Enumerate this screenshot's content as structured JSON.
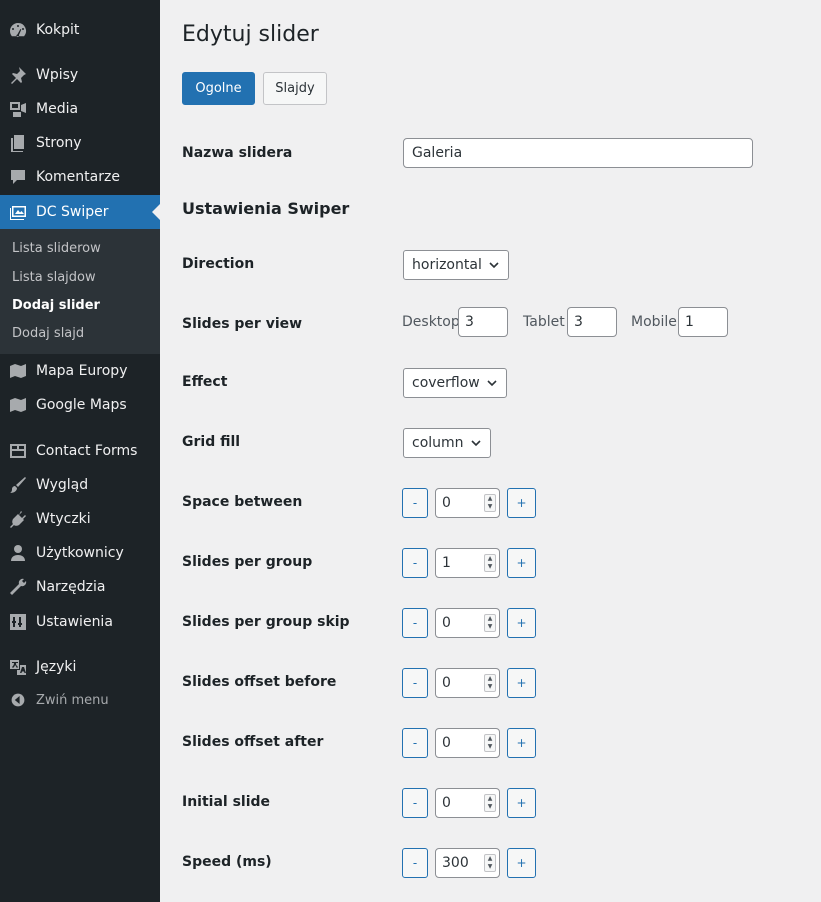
{
  "sidebar": {
    "items": [
      {
        "id": "kokpit",
        "label": "Kokpit",
        "icon": "dashboard-icon"
      },
      {
        "id": "wpisy",
        "label": "Wpisy",
        "icon": "pin-icon"
      },
      {
        "id": "media",
        "label": "Media",
        "icon": "media-icon"
      },
      {
        "id": "strony",
        "label": "Strony",
        "icon": "page-icon"
      },
      {
        "id": "komentarze",
        "label": "Komentarze",
        "icon": "comment-icon"
      },
      {
        "id": "dc-swiper",
        "label": "DC Swiper",
        "icon": "images-icon"
      },
      {
        "id": "mapa-europy",
        "label": "Mapa Europy",
        "icon": "map-icon"
      },
      {
        "id": "google-maps",
        "label": "Google Maps",
        "icon": "map-icon"
      },
      {
        "id": "contact-forms",
        "label": "Contact Forms",
        "icon": "forms-icon"
      },
      {
        "id": "wyglad",
        "label": "Wygląd",
        "icon": "brush-icon"
      },
      {
        "id": "wtyczki",
        "label": "Wtyczki",
        "icon": "plugin-icon"
      },
      {
        "id": "uzytkownicy",
        "label": "Użytkownicy",
        "icon": "user-icon"
      },
      {
        "id": "narzedzia",
        "label": "Narzędzia",
        "icon": "wrench-icon"
      },
      {
        "id": "ustawienia",
        "label": "Ustawienia",
        "icon": "settings-icon"
      },
      {
        "id": "jezyki",
        "label": "Języki",
        "icon": "translation-icon"
      }
    ],
    "submenu": [
      "Lista sliderow",
      "Lista slajdow",
      "Dodaj slider",
      "Dodaj slajd"
    ],
    "collapse_label": "Zwiń menu"
  },
  "page": {
    "title": "Edytuj slider",
    "tabs": {
      "general": "Ogolne",
      "slides": "Slajdy"
    }
  },
  "form": {
    "name_label": "Nazwa slidera",
    "name_value": "Galeria",
    "section_title": "Ustawienia Swiper",
    "direction_label": "Direction",
    "direction_value": "horizontal",
    "spv_label": "Slides per view",
    "spv": {
      "desktop_label": "Desktop",
      "desktop_value": "3",
      "tablet_label": "Tablet",
      "tablet_value": "3",
      "mobile_label": "Mobile",
      "mobile_value": "1"
    },
    "effect_label": "Effect",
    "effect_value": "coverflow",
    "grid_fill_label": "Grid fill",
    "grid_fill_value": "column",
    "minus": "-",
    "plus": "+",
    "numeric": [
      {
        "label": "Space between",
        "value": "0"
      },
      {
        "label": "Slides per group",
        "value": "1"
      },
      {
        "label": "Slides per group skip",
        "value": "0"
      },
      {
        "label": "Slides offset before",
        "value": "0"
      },
      {
        "label": "Slides offset after",
        "value": "0"
      },
      {
        "label": "Initial slide",
        "value": "0"
      },
      {
        "label": "Speed (ms)",
        "value": "300"
      }
    ]
  },
  "colors": {
    "accent": "#2271b1",
    "sidebar": "#1d2327",
    "submenu": "#2c3338",
    "background": "#f0f0f1"
  }
}
